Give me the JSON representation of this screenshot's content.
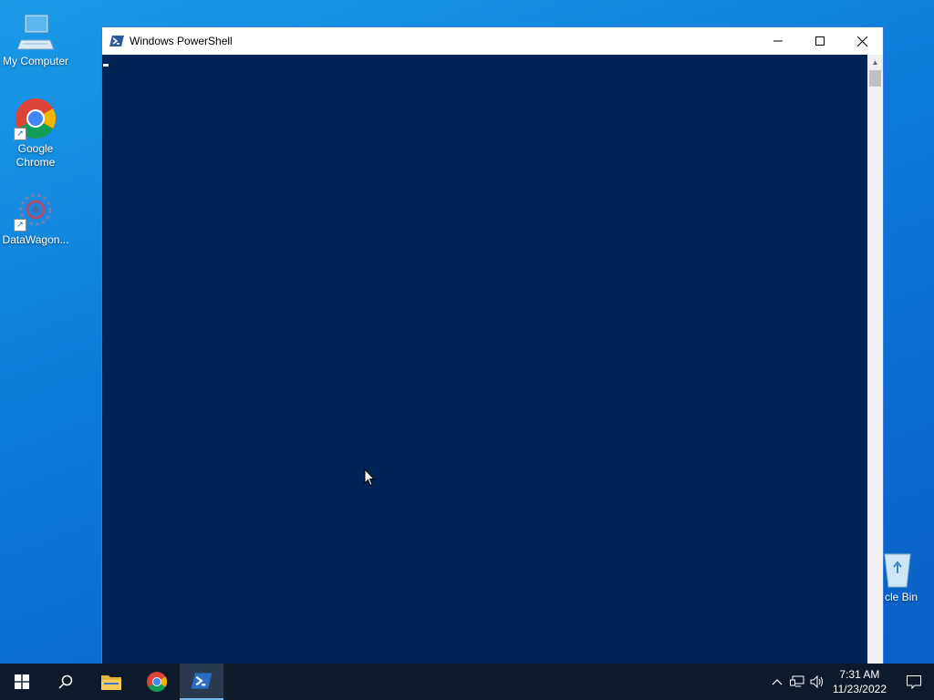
{
  "desktop": {
    "icons": [
      {
        "label": "My Computer",
        "icon": "my-computer-icon"
      },
      {
        "label": "Google Chrome",
        "icon": "chrome-icon"
      },
      {
        "label": "DataWagon...",
        "icon": "datawagon-icon"
      },
      {
        "label": "cle Bin",
        "icon": "recycle-bin-icon"
      }
    ]
  },
  "window": {
    "title": "Windows PowerShell",
    "minimize_icon": "minimize-icon",
    "maximize_icon": "maximize-icon",
    "close_icon": "close-icon",
    "console_background": "#012456",
    "console_text": ""
  },
  "taskbar": {
    "background": "#0c1a2a",
    "items": [
      {
        "name": "start",
        "icon": "windows-start-icon"
      },
      {
        "name": "search",
        "icon": "search-icon"
      },
      {
        "name": "file-explorer",
        "icon": "folder-icon"
      },
      {
        "name": "chrome",
        "icon": "chrome-icon"
      },
      {
        "name": "powershell",
        "icon": "powershell-icon",
        "active": true
      }
    ],
    "tray": {
      "time": "7:31 AM",
      "date": "11/23/2022",
      "icons": [
        "chevron-up-icon",
        "network-icon",
        "volume-icon",
        "notification-icon"
      ]
    }
  }
}
